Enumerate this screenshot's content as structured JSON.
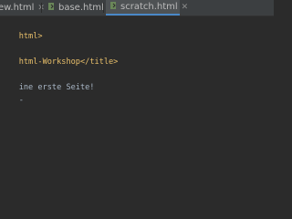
{
  "tabs": [
    {
      "label": "ew.html",
      "close": "✕",
      "active": false
    },
    {
      "label": "base.html",
      "close": "✕",
      "active": false
    },
    {
      "label": "scratch.html",
      "close": "✕",
      "active": true
    }
  ],
  "code": {
    "line1": "html>",
    "line3_tag_open": "html-Workshop",
    "line3_tag_close": "</title>",
    "line5": "ine erste Seite!",
    "line6": "-"
  }
}
